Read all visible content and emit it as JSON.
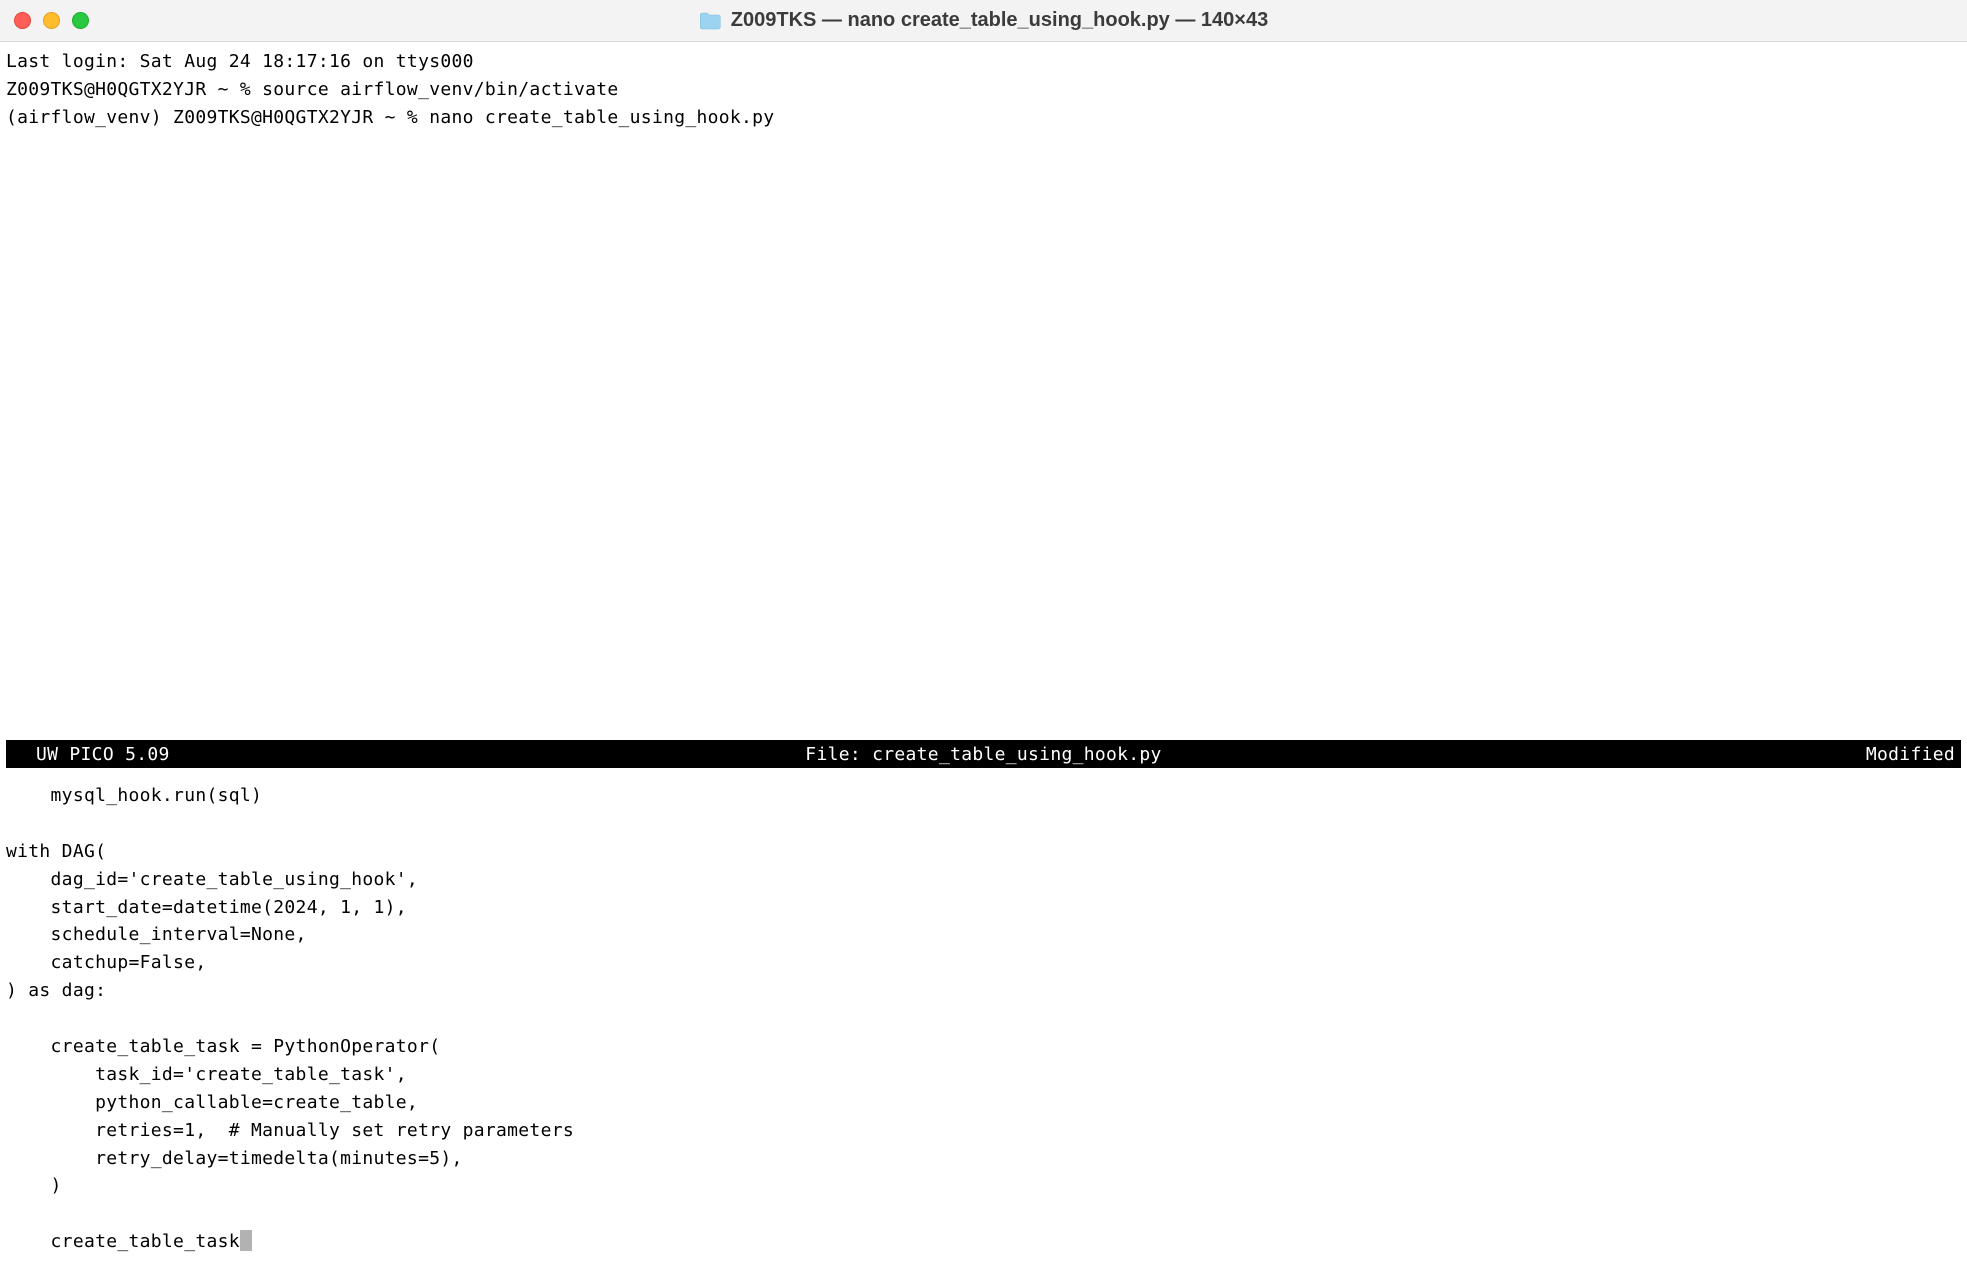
{
  "window": {
    "title": "Z009TKS — nano create_table_using_hook.py — 140×43"
  },
  "terminal": {
    "lines": "Last login: Sat Aug 24 18:17:16 on ttys000\nZ009TKS@H0QGTX2YJR ~ % source airflow_venv/bin/activate\n(airflow_venv) Z009TKS@H0QGTX2YJR ~ % nano create_table_using_hook.py"
  },
  "nano": {
    "header_left": "UW PICO 5.09",
    "header_center": "File: create_table_using_hook.py",
    "header_right": "Modified",
    "content": "    mysql_hook.run(sql)\n\nwith DAG(\n    dag_id='create_table_using_hook',\n    start_date=datetime(2024, 1, 1),\n    schedule_interval=None,\n    catchup=False,\n) as dag:\n\n    create_table_task = PythonOperator(\n        task_id='create_table_task',\n        python_callable=create_table,\n        retries=1,  # Manually set retry parameters\n        retry_delay=timedelta(minutes=5),\n    )\n\n    create_table_task"
  }
}
